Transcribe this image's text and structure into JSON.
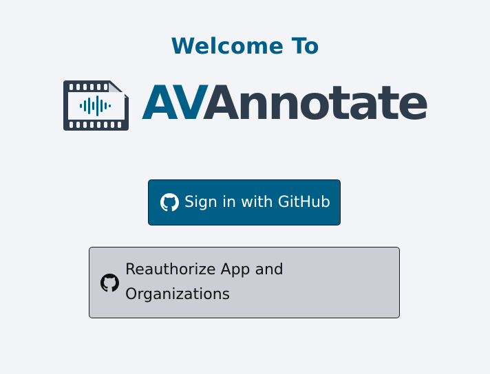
{
  "header": {
    "welcome_text": "Welcome To"
  },
  "logo": {
    "wordmark_accent": "AV",
    "wordmark_rest": "Annotate",
    "icon": "film-audio-waveform-icon"
  },
  "actions": {
    "github_signin_label": "Sign in with GitHub",
    "github_icon": "github-icon",
    "reauthorize_label": "Reauthorize App and Organizations"
  },
  "colors": {
    "background": "#f3f4f8",
    "brand_blue": "#005f87",
    "brand_dark": "#2e3c4b",
    "secondary_button": "#cbcfd5"
  }
}
